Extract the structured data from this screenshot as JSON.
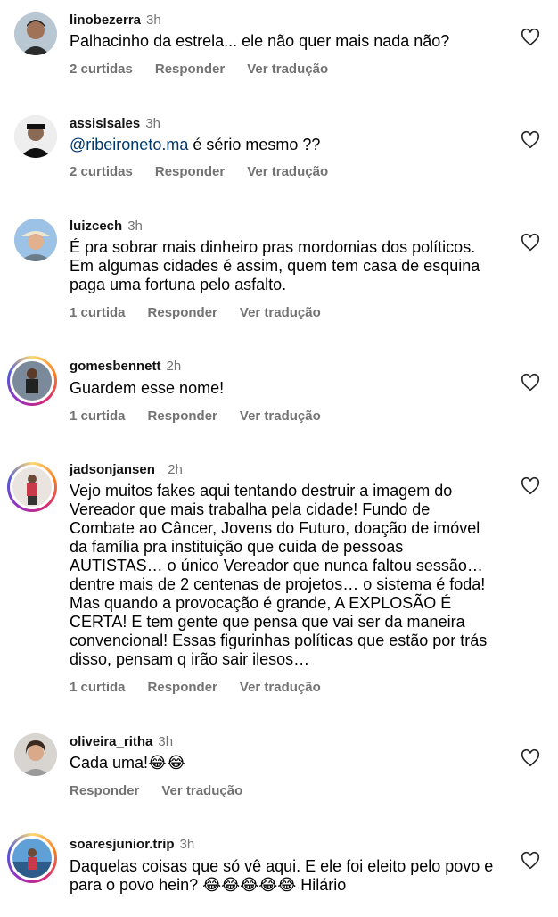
{
  "comments": [
    {
      "username": "linobezerra",
      "time": "3h",
      "text": "Palhacinho da estrela... ele não quer mais nada não?",
      "likes": "2 curtidas",
      "reply": "Responder",
      "translate": "Ver tradução"
    },
    {
      "username": "assislsales",
      "time": "3h",
      "mention": "@ribeironeto.ma",
      "text": " é sério mesmo ??",
      "likes": "2 curtidas",
      "reply": "Responder",
      "translate": "Ver tradução"
    },
    {
      "username": "luizcech",
      "time": "3h",
      "text": "É pra sobrar mais dinheiro pras mordomias dos políticos. Em algumas cidades é assim, quem tem casa de esquina paga uma fortuna pelo asfalto.",
      "likes": "1 curtida",
      "reply": "Responder",
      "translate": "Ver tradução"
    },
    {
      "username": "gomesbennett",
      "time": "2h",
      "text": "Guardem esse nome!",
      "likes": "1 curtida",
      "reply": "Responder",
      "translate": "Ver tradução"
    },
    {
      "username": "jadsonjansen_",
      "time": "2h",
      "text": "Vejo muitos fakes aqui tentando destruir a imagem do Vereador que mais trabalha pela cidade! Fundo de Combate ao Câncer, Jovens do Futuro, doação de imóvel da família pra instituição que cuida de pessoas AUTISTAS… o único Vereador que nunca faltou sessão… dentre mais de 2 centenas de projetos… o sistema é foda! Mas quando a provocação é grande, A EXPLOSÃO É CERTA! E tem gente que pensa que vai ser da maneira convencional! Essas figurinhas políticas que estão por trás disso, pensam q irão sair ilesos…",
      "likes": "1 curtida",
      "reply": "Responder",
      "translate": "Ver tradução"
    },
    {
      "username": "oliveira_ritha",
      "time": "3h",
      "text": "Cada uma!😂😂",
      "reply": "Responder",
      "translate": "Ver tradução"
    },
    {
      "username": "soaresjunior.trip",
      "time": "3h",
      "text": "Daquelas coisas que só vê aqui. E ele foi eleito pelo povo e para o povo hein? 😂😂😂😂😂 Hilário"
    }
  ],
  "icons": {
    "like": "heart-outline-icon"
  }
}
